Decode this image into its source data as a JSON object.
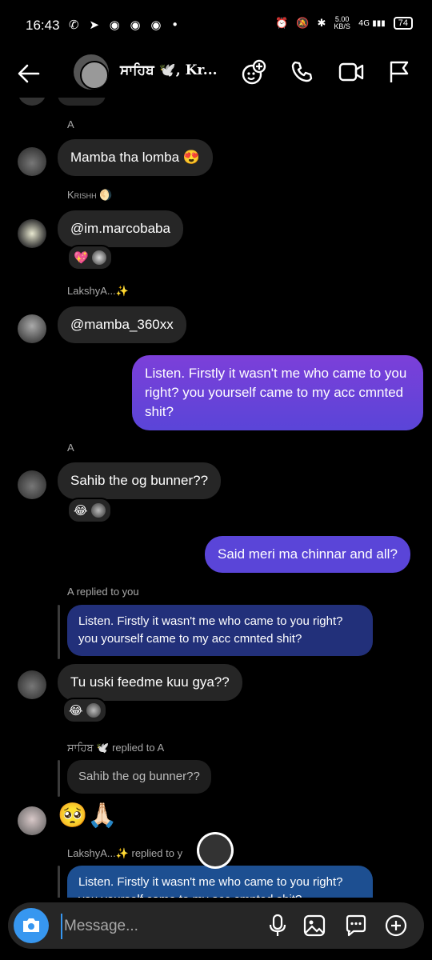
{
  "status": {
    "time": "16:43",
    "speed": "5.00",
    "speed_unit": "KB/S",
    "network": "4G",
    "battery": "74"
  },
  "header": {
    "title": "ਸਾਹਿਬ 🕊️, Kr..."
  },
  "messages": {
    "m1": {
      "sender": "A",
      "text": "Mamba tha lomba 😍"
    },
    "m2": {
      "sender": "Krishh 🌖",
      "text": "@im.marcobaba",
      "reaction": "💖"
    },
    "m3": {
      "sender": "LakshyA...✨",
      "text": "@mamba_360xx"
    },
    "m4": {
      "text": "Listen. Firstly it wasn't me who came to you right? you yourself came to my acc cmnted shit?"
    },
    "m5": {
      "sender": "A",
      "text": "Sahib the og bunner??",
      "reaction": "😂"
    },
    "m6": {
      "text": "Said meri ma chinnar and all?"
    },
    "m7": {
      "reply_label": "A replied to you",
      "quote": "Listen. Firstly it wasn't me who came to you right? you yourself came to my acc cmnted shit?",
      "text": "Tu uski feedme kuu gya??",
      "reaction": "😂"
    },
    "m8": {
      "reply_label": "ਸਾਹਿਬ 🕊️ replied to A",
      "quote": "Sahib the og bunner??",
      "text": "🥺🙏🏻"
    },
    "m9": {
      "reply_label": "LakshyA...✨ replied to y",
      "quote": "Listen. Firstly it wasn't me who came to you right? you yourself came to my acc cmnted shit?"
    }
  },
  "composer": {
    "placeholder": "Message..."
  },
  "colors": {
    "accent": "#3797f0",
    "outgoing": "#6a43d8",
    "incoming": "#262626"
  }
}
